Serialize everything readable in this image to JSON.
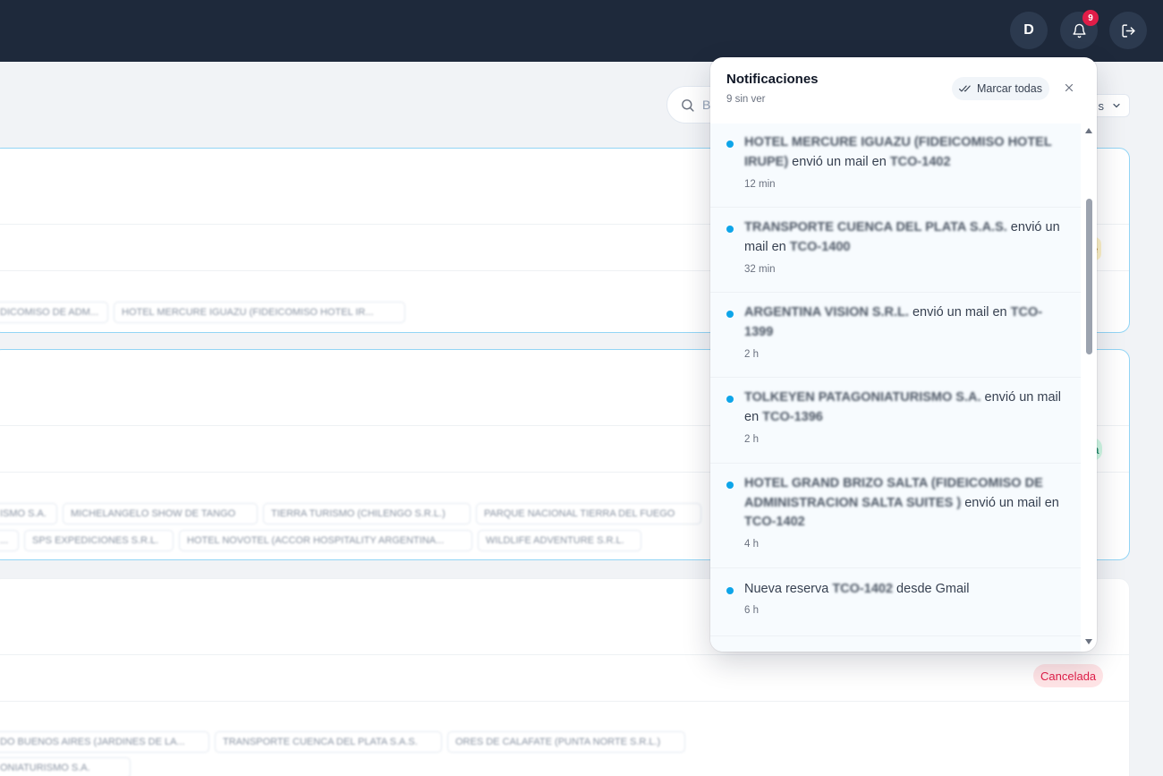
{
  "header": {
    "avatar_initial": "D",
    "notification_count": "9"
  },
  "toolbar": {
    "search_placeholder": "B",
    "filter_label": "s"
  },
  "cards": [
    {
      "chips": [
        "DICOMISO DE ADM...",
        "HOTEL MERCURE IGUAZU (FIDEICOMISO HOTEL IR..."
      ],
      "status": "e"
    },
    {
      "chips_row1": [
        "ISMO S.A.",
        "MICHELANGELO SHOW DE TANGO",
        "TIERRA TURISMO (CHILENGO S.R.L.)",
        "PARQUE NACIONAL TIERRA DEL FUEGO"
      ],
      "chips_row2": [
        "...",
        "SPS EXPEDICIONES S.R.L.",
        "HOTEL NOVOTEL (ACCOR HOSPITALITY ARGENTINA...",
        "WILDLIFE ADVENTURE S.R.L."
      ],
      "status": "da"
    },
    {
      "status": "Cancelada",
      "chips_row1": [
        "DO BUENOS AIRES (JARDINES DE LA...",
        "TRANSPORTE CUENCA DEL PLATA S.A.S.",
        "ORES DE CALAFATE (PUNTA NORTE S.R.L.)"
      ],
      "chips_row2": [
        "ONIATURISMO S.A."
      ]
    }
  ],
  "notifications_panel": {
    "title": "Notificaciones",
    "subtitle": "9 sin ver",
    "mark_all_label": "Marcar todas",
    "items": [
      {
        "sender": "HOTEL MERCURE IGUAZU (FIDEICOMISO HOTEL IRUPE)",
        "action": " envió un mail en ",
        "ref": "TCO-1402",
        "tail": "",
        "time": "12 min"
      },
      {
        "sender": "TRANSPORTE CUENCA DEL PLATA S.A.S.",
        "action": " envió un mail en ",
        "ref": "TCO-1400",
        "tail": "",
        "time": "32 min"
      },
      {
        "sender": "ARGENTINA VISION S.R.L.",
        "action": " envió un mail en ",
        "ref": "TCO-1399",
        "tail": "",
        "time": "2 h"
      },
      {
        "sender": "TOLKEYEN PATAGONIATURISMO S.A.",
        "action": " envió un mail en ",
        "ref": "TCO-1396",
        "tail": "",
        "time": "2 h"
      },
      {
        "sender": "HOTEL GRAND BRIZO SALTA (FIDEICOMISO DE ADMINISTRACION SALTA SUITES )",
        "action": " envió un mail en ",
        "ref": "TCO-1402",
        "tail": "",
        "time": "4 h"
      },
      {
        "sender": "Nueva reserva ",
        "action": "",
        "ref": "TCO-1402",
        "tail": " desde Gmail",
        "time": "6 h"
      }
    ]
  }
}
